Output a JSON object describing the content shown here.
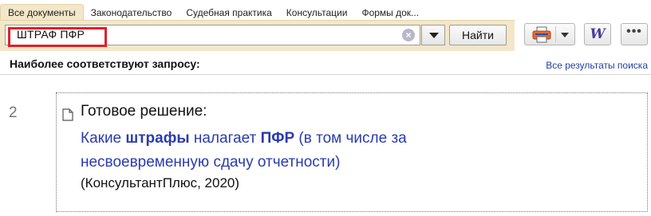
{
  "tabs": [
    {
      "label": "Все документы",
      "active": true
    },
    {
      "label": "Законодательство"
    },
    {
      "label": "Судебная практика"
    },
    {
      "label": "Консультации"
    },
    {
      "label": "Формы док..."
    }
  ],
  "search": {
    "value": "ШТРАФ ПФР",
    "find_label": "Найти"
  },
  "toolbar": {
    "word_label": "W",
    "more_label": "•••"
  },
  "results": {
    "header": "Наиболее соответствуют запросу:",
    "all_link": "Все результаты поиска",
    "item": {
      "number": "2",
      "type": "Готовое решение:",
      "title_parts": [
        "Какие ",
        "штрафы",
        " налагает ",
        "ПФР",
        " (в том числе за несвоевременную сдачу отчетности)"
      ],
      "source": "(КонсультантПлюс, 2020)"
    }
  },
  "colors": {
    "bar": "#f3e7c9",
    "highlight": "#e0202a",
    "link": "#2a3bb0"
  }
}
